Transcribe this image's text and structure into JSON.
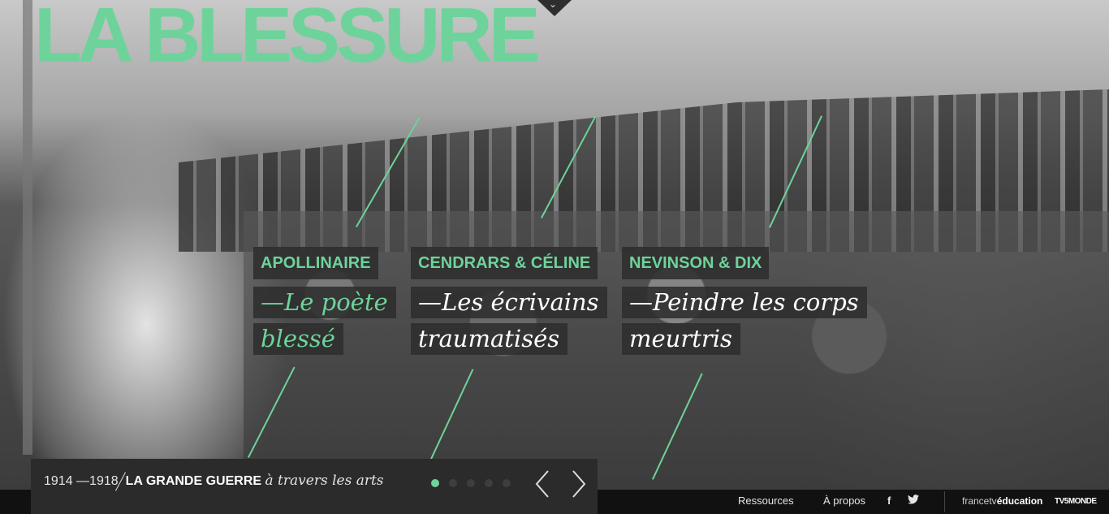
{
  "header": {
    "title": "LA BLESSURE",
    "menu_icon": "chevron-down-icon"
  },
  "stories": [
    {
      "name": "APOLLINAIRE",
      "subtitle": "—Le poète blessé",
      "active": true
    },
    {
      "name": "CENDRARS & CÉLINE",
      "subtitle": "—Les écrivains traumatisés",
      "active": false
    },
    {
      "name": "NEVINSON & DIX",
      "subtitle": "—Peindre les corps meurtris",
      "active": false
    }
  ],
  "series": {
    "years": "1914 —1918",
    "name": "LA GRANDE GUERRE",
    "tagline": "à travers les arts"
  },
  "pagination": {
    "count": 5,
    "active_index": 0
  },
  "controls": {
    "prev_icon": "chevron-left-icon",
    "next_icon": "chevron-right-icon"
  },
  "footer": {
    "links": [
      "Ressources",
      "À propos"
    ],
    "social": {
      "facebook": "f",
      "twitter": "🐦"
    },
    "brand_ftv": {
      "prefix": "francetv",
      "suffix": "éducation"
    },
    "brand_tv5": "TV5MONDE"
  },
  "colors": {
    "accent": "#6ed39a",
    "panel": "#2b2b2b"
  }
}
